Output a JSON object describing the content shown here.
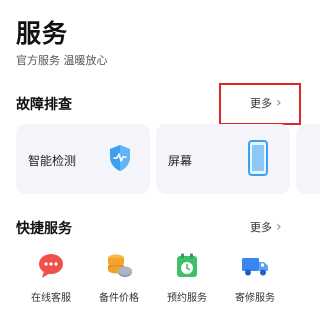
{
  "header": {
    "title": "服务",
    "subtitle": "官方服务 温暖放心"
  },
  "troubleshooting": {
    "title": "故障排查",
    "more_label": "更多",
    "cards": [
      {
        "label": "智能检测",
        "icon": "shield-check-icon"
      },
      {
        "label": "屏幕",
        "icon": "phone-screen-icon"
      }
    ]
  },
  "quick_services": {
    "title": "快捷服务",
    "more_label": "更多",
    "items": [
      {
        "label": "在线客服",
        "icon": "chat-bubble-icon",
        "color": "#f0504a"
      },
      {
        "label": "备件价格",
        "icon": "coins-icon",
        "color": "#f2a32b"
      },
      {
        "label": "预约服务",
        "icon": "calendar-clock-icon",
        "color": "#3fbf6a"
      },
      {
        "label": "寄修服务",
        "icon": "delivery-truck-icon",
        "color": "#3a86f0"
      }
    ]
  },
  "colors": {
    "highlight": "#e0262b",
    "card_background": "#f3f5fa"
  }
}
